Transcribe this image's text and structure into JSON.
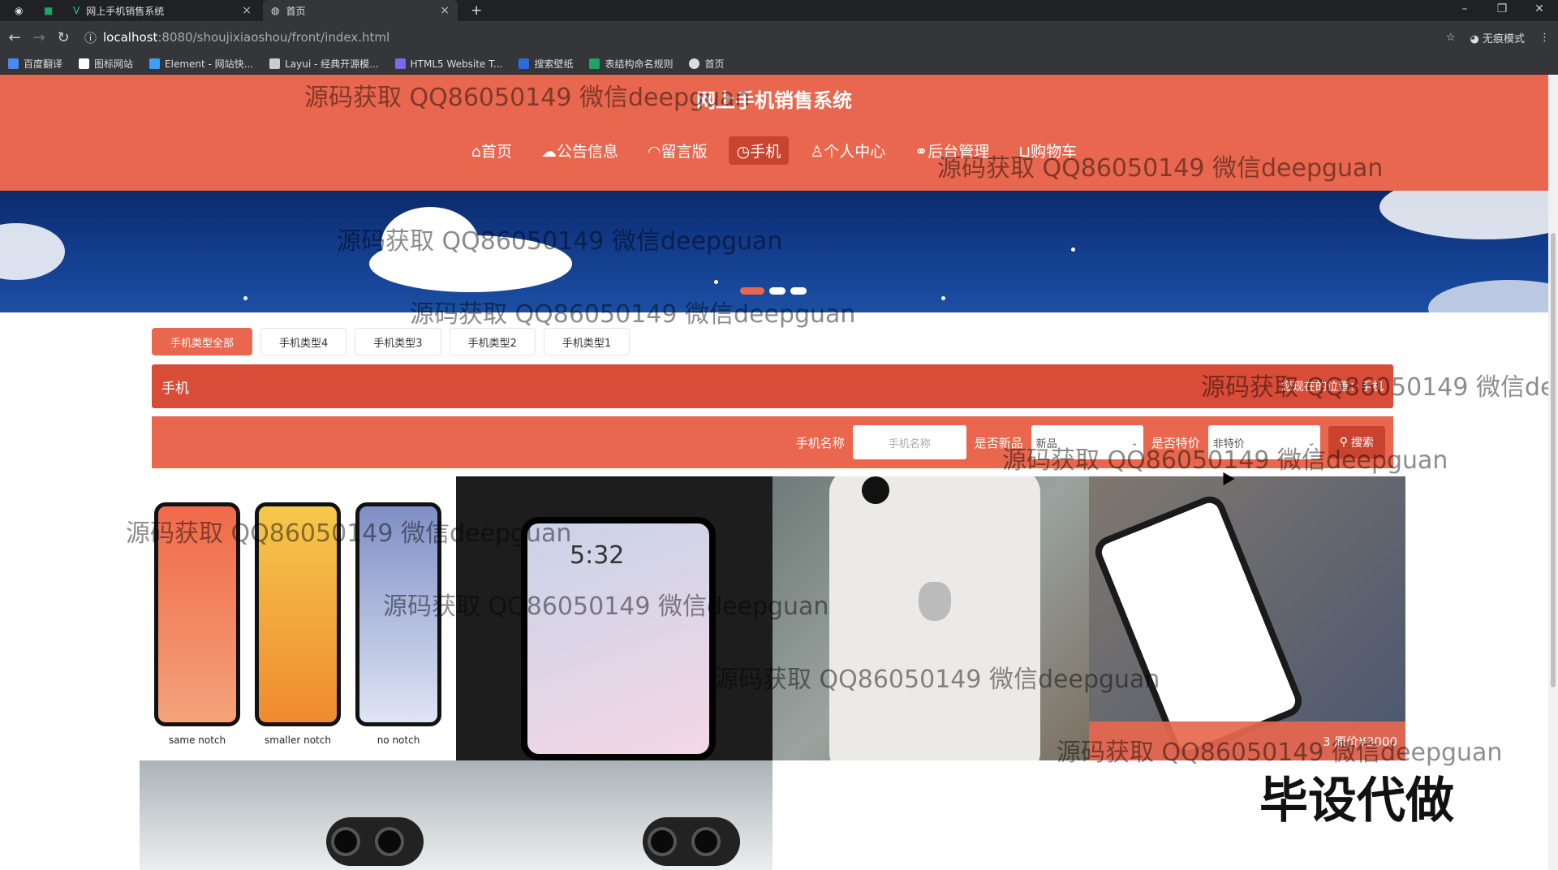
{
  "browser": {
    "tabs": [
      {
        "title": ""
      },
      {
        "title": ""
      },
      {
        "title": "网上手机销售系统"
      },
      {
        "title": "首页"
      }
    ],
    "new_tab": "+",
    "address": {
      "host": "localhost",
      "path": ":8080/shoujixiaoshou/front/index.html"
    },
    "incognito": "无痕模式",
    "bookmarks": [
      "百度翻译",
      "图标网站",
      "Element - 网站快...",
      "Layui - 经典开源模...",
      "HTML5 Website T...",
      "搜索壁纸",
      "表结构命名规则",
      "首页"
    ]
  },
  "site": {
    "title": "网上手机销售系统",
    "nav": [
      "首页",
      "公告信息",
      "留言版",
      "手机",
      "个人中心",
      "后台管理",
      "购物车"
    ],
    "nav_active": 3
  },
  "categories": [
    "手机类型全部",
    "手机类型4",
    "手机类型3",
    "手机类型2",
    "手机类型1"
  ],
  "crumb": {
    "title": "手机",
    "location": "您现在的位置：手机"
  },
  "search": {
    "name_label": "手机名称",
    "name_placeholder": "手机名称",
    "new_label": "是否新品",
    "new_value": "新品",
    "special_label": "是否特价",
    "special_value": "非特价",
    "button": "搜索"
  },
  "products": {
    "notch_labels": [
      "same notch",
      "smaller notch",
      "no notch"
    ],
    "phone_time": "5:32",
    "caption": "3 原价¥3000"
  },
  "watermark": "源码获取 QQ86050149 微信deepguan",
  "stamp": "毕设代做",
  "colors": {
    "accent": "#e8674e",
    "accent_dark": "#d94c37"
  }
}
